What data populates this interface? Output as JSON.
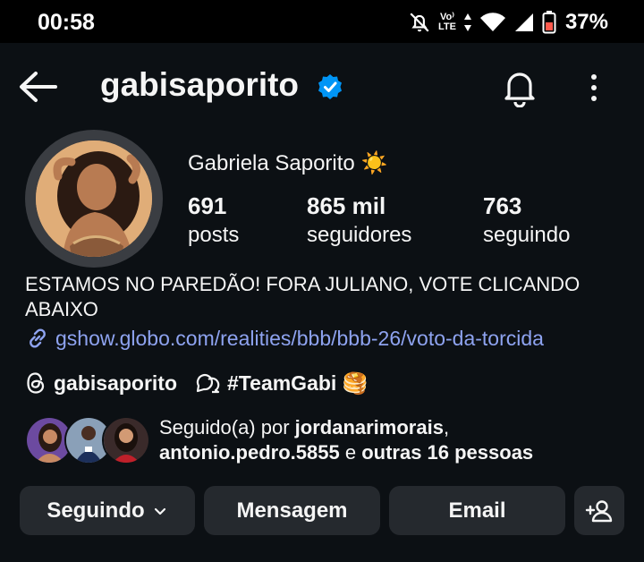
{
  "status_bar": {
    "time": "00:58",
    "network": "Vo LTE",
    "battery": "37%"
  },
  "header": {
    "username": "gabisaporito"
  },
  "profile": {
    "full_name": "Gabriela Saporito ☀️",
    "stats": [
      {
        "value": "691",
        "label": "posts"
      },
      {
        "value": "865 mil",
        "label": "seguidores"
      },
      {
        "value": "763",
        "label": "seguindo"
      }
    ],
    "bio": "ESTAMOS NO PAREDÃO! FORA JULIANO, VOTE CLICANDO ABAIXO",
    "link": "gshow.globo.com/realities/bbb/bbb-26/voto-da-torcida",
    "threads_handle": "gabisaporito",
    "community": "#TeamGabi 🥞"
  },
  "followed_by": {
    "prefix": "Seguido(a) por ",
    "user1": "jordanarimorais",
    "comma": ",",
    "user2": "antonio.pedro.5855",
    "middle": " e ",
    "others": "outras 16 pessoas"
  },
  "actions": {
    "following_label": "Seguindo",
    "message_label": "Mensagem",
    "email_label": "Email"
  },
  "colors": {
    "background": "#0c1014",
    "button": "#25292e",
    "link": "#8ea3f0",
    "verified": "#0095f6"
  }
}
